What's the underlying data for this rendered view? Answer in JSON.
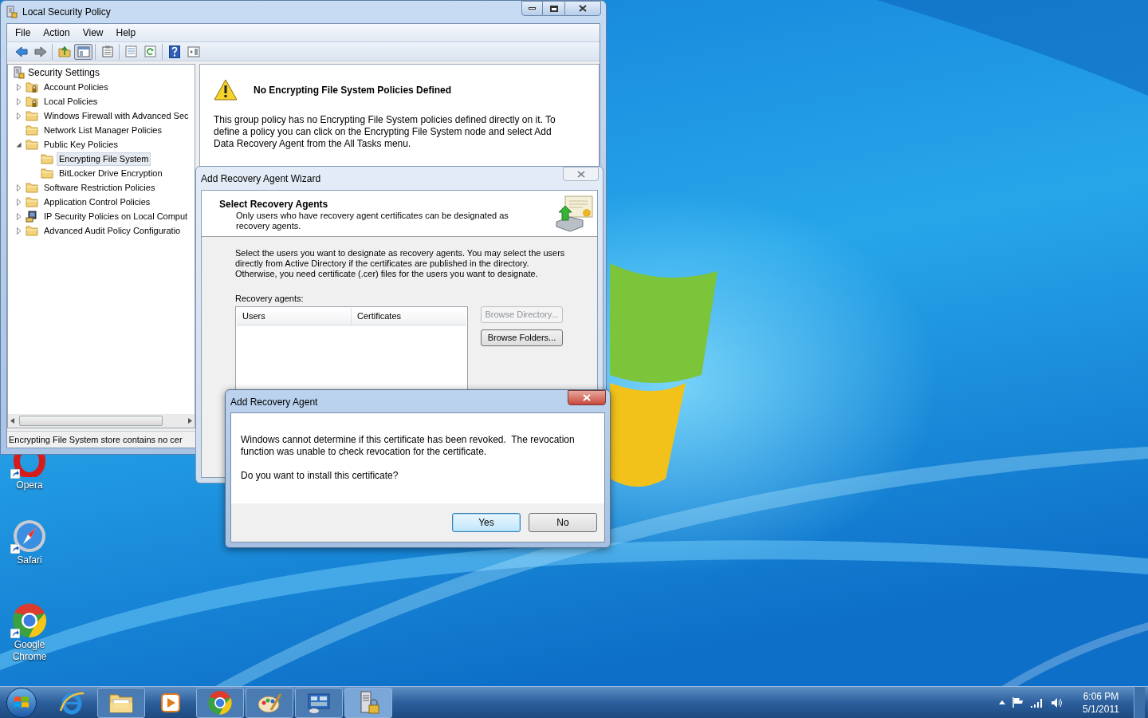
{
  "desktop_icons": [
    {
      "label": "Opera",
      "kind": "opera"
    },
    {
      "label": "Safari",
      "kind": "safari"
    },
    {
      "label": "Google Chrome",
      "kind": "chrome"
    }
  ],
  "main_window": {
    "title": "Local Security Policy",
    "menu": [
      "File",
      "Action",
      "View",
      "Help"
    ],
    "toolbar": [
      [
        {
          "kind": "back",
          "pressed": false
        },
        {
          "kind": "forward",
          "pressed": false
        }
      ],
      [
        {
          "kind": "up-folder",
          "pressed": false
        },
        {
          "kind": "console-tree",
          "pressed": true
        }
      ],
      [
        {
          "kind": "properties",
          "pressed": false
        }
      ],
      [
        {
          "kind": "export",
          "pressed": false
        },
        {
          "kind": "refresh",
          "pressed": false
        }
      ],
      [
        {
          "kind": "help",
          "pressed": false
        },
        {
          "kind": "action-pane",
          "pressed": false
        }
      ]
    ],
    "tree_root": "Security Settings",
    "tree": [
      {
        "label": "Account Policies",
        "kind": "locked-folder",
        "expanded": false,
        "selected": false
      },
      {
        "label": "Local Policies",
        "kind": "locked-folder",
        "expanded": false,
        "selected": false
      },
      {
        "label": "Windows Firewall with Advanced Sec",
        "kind": "folder",
        "expanded": false,
        "selected": false
      },
      {
        "label": "Network List Manager Policies",
        "kind": "folder",
        "selected": false
      },
      {
        "label": "Public Key Policies",
        "kind": "folder",
        "expanded": true,
        "selected": false,
        "children": [
          {
            "label": "Encrypting File System",
            "kind": "folder",
            "selected": true
          },
          {
            "label": "BitLocker Drive Encryption",
            "kind": "folder",
            "selected": false
          }
        ]
      },
      {
        "label": "Software Restriction Policies",
        "kind": "folder",
        "expanded": false,
        "selected": false
      },
      {
        "label": "Application Control Policies",
        "kind": "folder",
        "expanded": false,
        "selected": false
      },
      {
        "label": "IP Security Policies on Local Comput",
        "kind": "network",
        "expanded": false,
        "selected": false
      },
      {
        "label": "Advanced Audit Policy Configuratio",
        "kind": "folder",
        "expanded": false,
        "selected": false
      }
    ],
    "details": {
      "heading": "No Encrypting File System Policies Defined",
      "text": "This group policy has no Encrypting File System policies defined directly on it.  To define a policy you can click on the Encrypting File System node and select Add Data Recovery Agent from the All Tasks menu."
    },
    "status_bar": "Encrypting File System store contains no cer"
  },
  "wizard": {
    "title": "Add Recovery Agent Wizard",
    "heading": "Select Recovery Agents",
    "subheading": "Only users who have recovery agent certificates can be designated as recovery agents.",
    "text": "Select the users you want to designate as recovery agents. You may select the users directly from Active Directory if the certificates are published in the directory. Otherwise, you need certificate (.cer) files for the users you want to designate.",
    "list_label": "Recovery agents:",
    "columns": [
      "Users",
      "Certificates"
    ],
    "buttons": [
      {
        "label": "Browse Directory...",
        "disabled": true
      },
      {
        "label": "Browse Folders...",
        "disabled": false
      }
    ]
  },
  "dialog": {
    "title": "Add Recovery Agent",
    "message": "Windows cannot determine if this certificate has been revoked.  The revocation function was unable to check revocation for the certificate.",
    "question": "Do you want to install this certificate?",
    "buttons": [
      {
        "label": "Yes",
        "default": true
      },
      {
        "label": "No",
        "default": false
      }
    ]
  },
  "taskbar": {
    "items": [
      {
        "kind": "ie",
        "running": false,
        "active": false
      },
      {
        "kind": "explorer",
        "running": true,
        "active": false
      },
      {
        "kind": "media",
        "running": false,
        "active": false
      },
      {
        "kind": "chrome",
        "running": true,
        "active": false
      },
      {
        "kind": "paint",
        "running": true,
        "active": false
      },
      {
        "kind": "control-panel",
        "running": true,
        "active": false
      },
      {
        "kind": "security-policy",
        "running": true,
        "active": true
      }
    ],
    "time": "6:06 PM",
    "date": "5/1/2011"
  }
}
